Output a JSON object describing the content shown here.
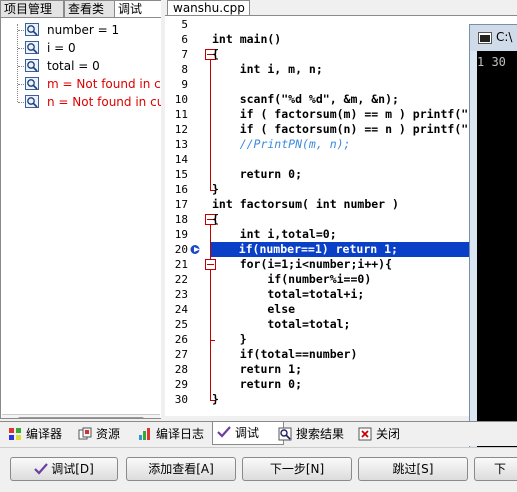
{
  "left_panel": {
    "tabs": [
      "项目管理",
      "查看类",
      "调试"
    ],
    "watch_items": [
      {
        "label": "number = 1",
        "error": false
      },
      {
        "label": "i = 0",
        "error": false
      },
      {
        "label": "total = 0",
        "error": false
      },
      {
        "label": "m = Not found in cu",
        "error": true
      },
      {
        "label": "n = Not found in cur",
        "error": true
      }
    ],
    "scroll_thumb_grip": "|||"
  },
  "editor": {
    "file_tab": "wanshu.cpp",
    "line_numbers": [
      "5",
      "6",
      "7",
      "8",
      "9",
      "10",
      "11",
      "12",
      "13",
      "14",
      "15",
      "16",
      "17",
      "18",
      "19",
      "20",
      "21",
      "22",
      "23",
      "24",
      "25",
      "26",
      "27",
      "28",
      "29",
      "30"
    ],
    "lines": [
      "",
      "int main()",
      "{",
      "    int i, m, n;",
      "",
      "    scanf(\"%d %d\", &m, &n);",
      "    if ( factorsum(m) == m ) printf(\"",
      "    if ( factorsum(n) == n ) printf(\"",
      "    //PrintPN(m, n);",
      "",
      "    return 0;",
      "}",
      "int factorsum( int number )",
      "{",
      "    int i,total=0;",
      "    if(number==1) return 1;",
      "    for(i=1;i<number;i++){",
      "        if(number%i==0)",
      "        total=total+i;",
      "        else",
      "        total=total;",
      "    }",
      "    if(total==number)",
      "    return 1;",
      "    return 0;",
      "}"
    ],
    "current_line_index": 15,
    "comment_line_index": 8,
    "colors": {
      "highlight": "#0a3fc7",
      "comment": "#3a8ae0",
      "fold": "#c00000"
    }
  },
  "console": {
    "title": "C:\\",
    "output": "1 30"
  },
  "bottom_tabs": [
    {
      "label": "编译器",
      "icon": "compiler-icon"
    },
    {
      "label": "资源",
      "icon": "resources-icon"
    },
    {
      "label": "编译日志",
      "icon": "compile-log-icon"
    },
    {
      "label": "调试",
      "icon": "debug-check-icon",
      "active": true
    },
    {
      "label": "搜索结果",
      "icon": "search-results-icon"
    },
    {
      "label": "关闭",
      "icon": "close-icon"
    }
  ],
  "buttons": {
    "debug": "调试[D]",
    "add_watch": "添加查看[A]",
    "next_step": "下一步[N]",
    "skip": "跳过[S]",
    "last": "下"
  }
}
